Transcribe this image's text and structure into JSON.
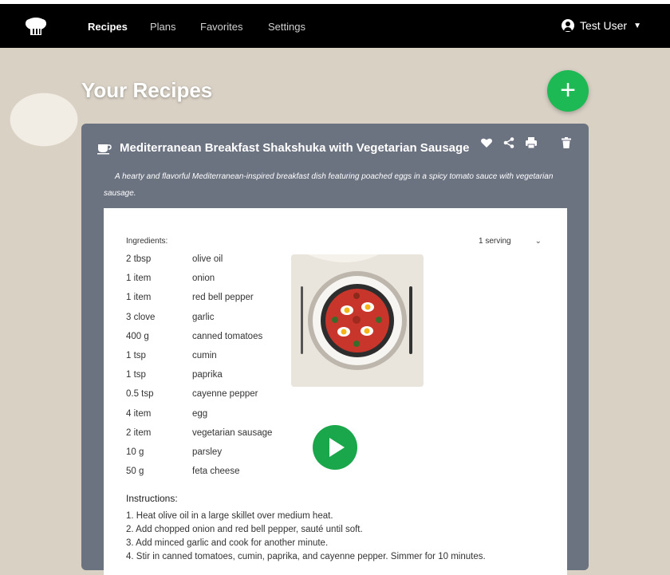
{
  "nav": {
    "items": [
      {
        "label": "Recipes",
        "active": true
      },
      {
        "label": "Plans",
        "active": false
      },
      {
        "label": "Favorites",
        "active": false
      },
      {
        "label": "Settings",
        "active": false
      }
    ],
    "user_name": "Test User",
    "logo_icon": "chef-hat-icon"
  },
  "page": {
    "title": "Your Recipes",
    "add_button_label": "+"
  },
  "recipe": {
    "icon": "coffee-cup-icon",
    "title": "Mediterranean Breakfast Shakshuka with Vegetarian Sausage",
    "description": "A hearty and flavorful Mediterranean-inspired breakfast dish featuring poached eggs in a spicy tomato sauce with vegetarian sausage.",
    "actions": [
      "heart-icon",
      "share-icon",
      "print-icon",
      "trash-icon"
    ],
    "ingredients_label": "Ingredients:",
    "serving": "1 serving",
    "ingredients": [
      {
        "qty": "2 tbsp",
        "name": "olive oil"
      },
      {
        "qty": "1 item",
        "name": "onion"
      },
      {
        "qty": "1 item",
        "name": "red bell pepper"
      },
      {
        "qty": "3 clove",
        "name": "garlic"
      },
      {
        "qty": "400 g",
        "name": "canned tomatoes"
      },
      {
        "qty": "1 tsp",
        "name": "cumin"
      },
      {
        "qty": "1 tsp",
        "name": "paprika"
      },
      {
        "qty": "0.5 tsp",
        "name": "cayenne pepper"
      },
      {
        "qty": "4 item",
        "name": "egg"
      },
      {
        "qty": "2 item",
        "name": "vegetarian sausage"
      },
      {
        "qty": "10 g",
        "name": "parsley"
      },
      {
        "qty": "50 g",
        "name": "feta cheese"
      }
    ],
    "instructions_label": "Instructions:",
    "instructions": [
      "1. Heat olive oil in a large skillet over medium heat.",
      "2. Add chopped onion and red bell pepper, sauté until soft.",
      "3. Add minced garlic and cook for another minute.",
      "4. Stir in canned tomatoes, cumin, paprika, and cayenne pepper. Simmer for 10 minutes."
    ]
  },
  "colors": {
    "accent_green": "#1db954",
    "card_bg": "#6b7280",
    "navbar_bg": "#000000"
  }
}
